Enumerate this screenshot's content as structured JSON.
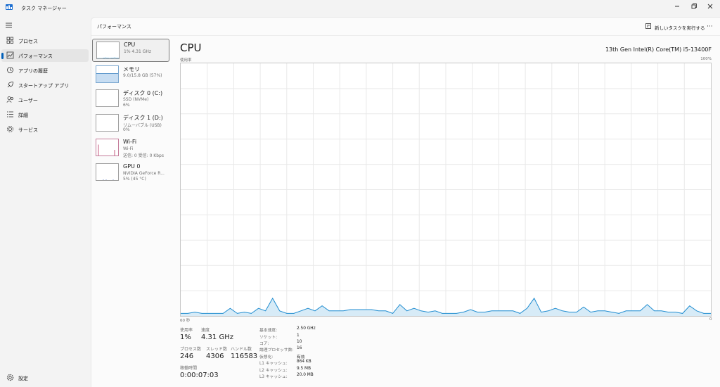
{
  "window": {
    "title": "タスク マネージャー"
  },
  "sidebar": {
    "items": [
      {
        "label": "プロセス",
        "icon": "processes-icon"
      },
      {
        "label": "パフォーマンス",
        "icon": "performance-icon",
        "active": true
      },
      {
        "label": "アプリの履歴",
        "icon": "app-history-icon"
      },
      {
        "label": "スタートアップ アプリ",
        "icon": "startup-icon"
      },
      {
        "label": "ユーザー",
        "icon": "users-icon"
      },
      {
        "label": "詳細",
        "icon": "details-icon"
      },
      {
        "label": "サービス",
        "icon": "services-icon"
      }
    ],
    "settings_label": "設定"
  },
  "header": {
    "title": "パフォーマンス",
    "run_task_label": "新しいタスクを実行する",
    "more_label": "···"
  },
  "resources": [
    {
      "name": "CPU",
      "sub1": "1%  4.31 GHz",
      "sub2": ""
    },
    {
      "name": "メモリ",
      "sub1": "9.0/15.8 GB (57%)",
      "sub2": ""
    },
    {
      "name": "ディスク 0 (C:)",
      "sub1": "SSD (NVMe)",
      "sub2": "6%"
    },
    {
      "name": "ディスク 1 (D:)",
      "sub1": "リムーバブル (USB)",
      "sub2": "0%"
    },
    {
      "name": "Wi-Fi",
      "sub1": "Wi-Fi",
      "sub2": "送信: 0 受信: 0 Kbps"
    },
    {
      "name": "GPU 0",
      "sub1": "NVIDIA GeForce R...",
      "sub2": "5% (45 °C)"
    }
  ],
  "detail": {
    "title": "CPU",
    "model": "13th Gen Intel(R) Core(TM) i5-13400F",
    "graph_label_top_left": "使用率",
    "graph_label_top_right": "100%",
    "graph_label_bottom_left": "60 秒",
    "graph_label_bottom_right": "0",
    "stats": {
      "usage_label": "使用率",
      "usage_value": "1%",
      "speed_label": "速度",
      "speed_value": "4.31 GHz",
      "processes_label": "プロセス数",
      "processes_value": "246",
      "threads_label": "スレッド数",
      "threads_value": "4306",
      "handles_label": "ハンドル数",
      "handles_value": "116583",
      "uptime_label": "稼働時間",
      "uptime_value": "0:00:07:03"
    },
    "specs": [
      {
        "k": "基本速度:",
        "v": "2.50 GHz"
      },
      {
        "k": "ソケット:",
        "v": "1"
      },
      {
        "k": "コア:",
        "v": "10"
      },
      {
        "k": "論理プロセッサ数:",
        "v": "16"
      },
      {
        "k": "仮想化:",
        "v": "有効"
      },
      {
        "k": "L1 キャッシュ:",
        "v": "864 KB"
      },
      {
        "k": "L2 キャッシュ:",
        "v": "9.5 MB"
      },
      {
        "k": "L3 キャッシュ:",
        "v": "20.0 MB"
      }
    ]
  },
  "chart_data": {
    "type": "area",
    "xlabel": "",
    "ylabel": "使用率",
    "ylim": [
      0,
      100
    ],
    "x_range": [
      60,
      0
    ],
    "values": [
      1,
      1,
      1.5,
      1,
      1,
      1,
      1,
      3,
      1,
      1.5,
      1,
      3,
      2,
      7,
      2,
      1,
      1,
      2,
      3,
      2,
      4,
      2,
      2,
      2,
      2.5,
      2.5,
      2.5,
      2.5,
      2,
      2,
      1,
      4.5,
      2,
      3,
      2,
      1.5,
      2,
      1,
      1,
      1,
      1.5,
      2.5,
      1.5,
      1.5,
      2,
      2,
      2,
      2,
      1,
      3,
      7,
      1.5,
      2,
      3,
      2,
      1.5,
      1.5,
      3.5,
      1.5,
      2,
      2,
      1.5,
      1,
      2,
      2,
      2,
      4.5,
      2,
      2,
      1.5,
      1.5,
      1,
      4,
      2,
      1,
      1
    ],
    "colors": {
      "line": "#1f8cd0",
      "fill": "#d7ebf7",
      "grid": "#e9e9e9"
    }
  },
  "thumbnails": {
    "memory_fill_percent": 57,
    "wifi_spikes": [
      0.7,
      0.4
    ],
    "gpu_dots": 3
  }
}
